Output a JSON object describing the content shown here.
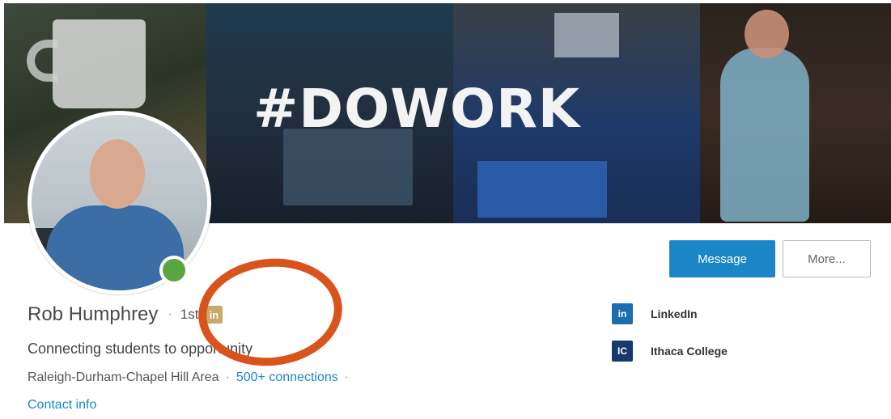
{
  "cover": {
    "title": "#DOWORK"
  },
  "profile": {
    "name": "Rob Humphrey",
    "separator": "·",
    "connection_degree": "1st",
    "badge_text": "in",
    "headline": "Connecting students to opportunity",
    "location": "Raleigh-Durham-Chapel Hill Area",
    "connections": "500+ connections",
    "contact_info": "Contact info",
    "online": true
  },
  "actions": {
    "message_label": "Message",
    "more_label": "More..."
  },
  "sidebar": {
    "items": [
      {
        "label": "LinkedIn",
        "logo": "in"
      },
      {
        "label": "Ithaca College",
        "logo": "IC"
      }
    ]
  },
  "colors": {
    "accent": "#1b86c7",
    "online": "#5aa540",
    "premium_badge": "#c9a86a",
    "annotation": "#d9541c"
  },
  "icons": {
    "online_indicator": "online-status-dot",
    "premium": "linkedin-premium-icon",
    "company": "linkedin-logo-icon",
    "school": "ithaca-college-logo-icon"
  }
}
